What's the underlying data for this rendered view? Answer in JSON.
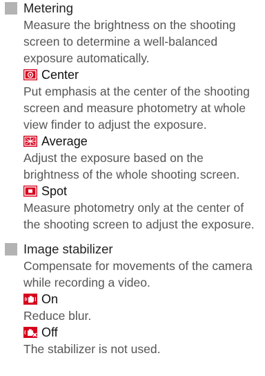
{
  "metering": {
    "title": "Metering",
    "description": "Measure the brightness on the shooting screen to determine a well-balanced exposure automatically.",
    "options": [
      {
        "icon": "center-metering-icon",
        "label": "Center",
        "description": "Put emphasis at the center of the shooting screen and measure photometry at whole view finder to adjust the exposure."
      },
      {
        "icon": "average-metering-icon",
        "label": "Average",
        "description": "Adjust the exposure based on the brightness of the whole shooting screen."
      },
      {
        "icon": "spot-metering-icon",
        "label": "Spot",
        "description": "Measure photometry only at the center of the shooting screen to adjust the exposure."
      }
    ]
  },
  "image_stabilizer": {
    "title": "Image stabilizer",
    "description": "Compensate for movements of the camera while recording a video.",
    "options": [
      {
        "icon": "stabilizer-on-icon",
        "label": "On",
        "description": "Reduce blur."
      },
      {
        "icon": "stabilizer-off-icon",
        "label": "Off",
        "description": "The stabilizer is not used."
      }
    ]
  },
  "colors": {
    "bullet": "#b3b3b3",
    "icon_background": "#d6001c",
    "body_text": "#555555"
  }
}
